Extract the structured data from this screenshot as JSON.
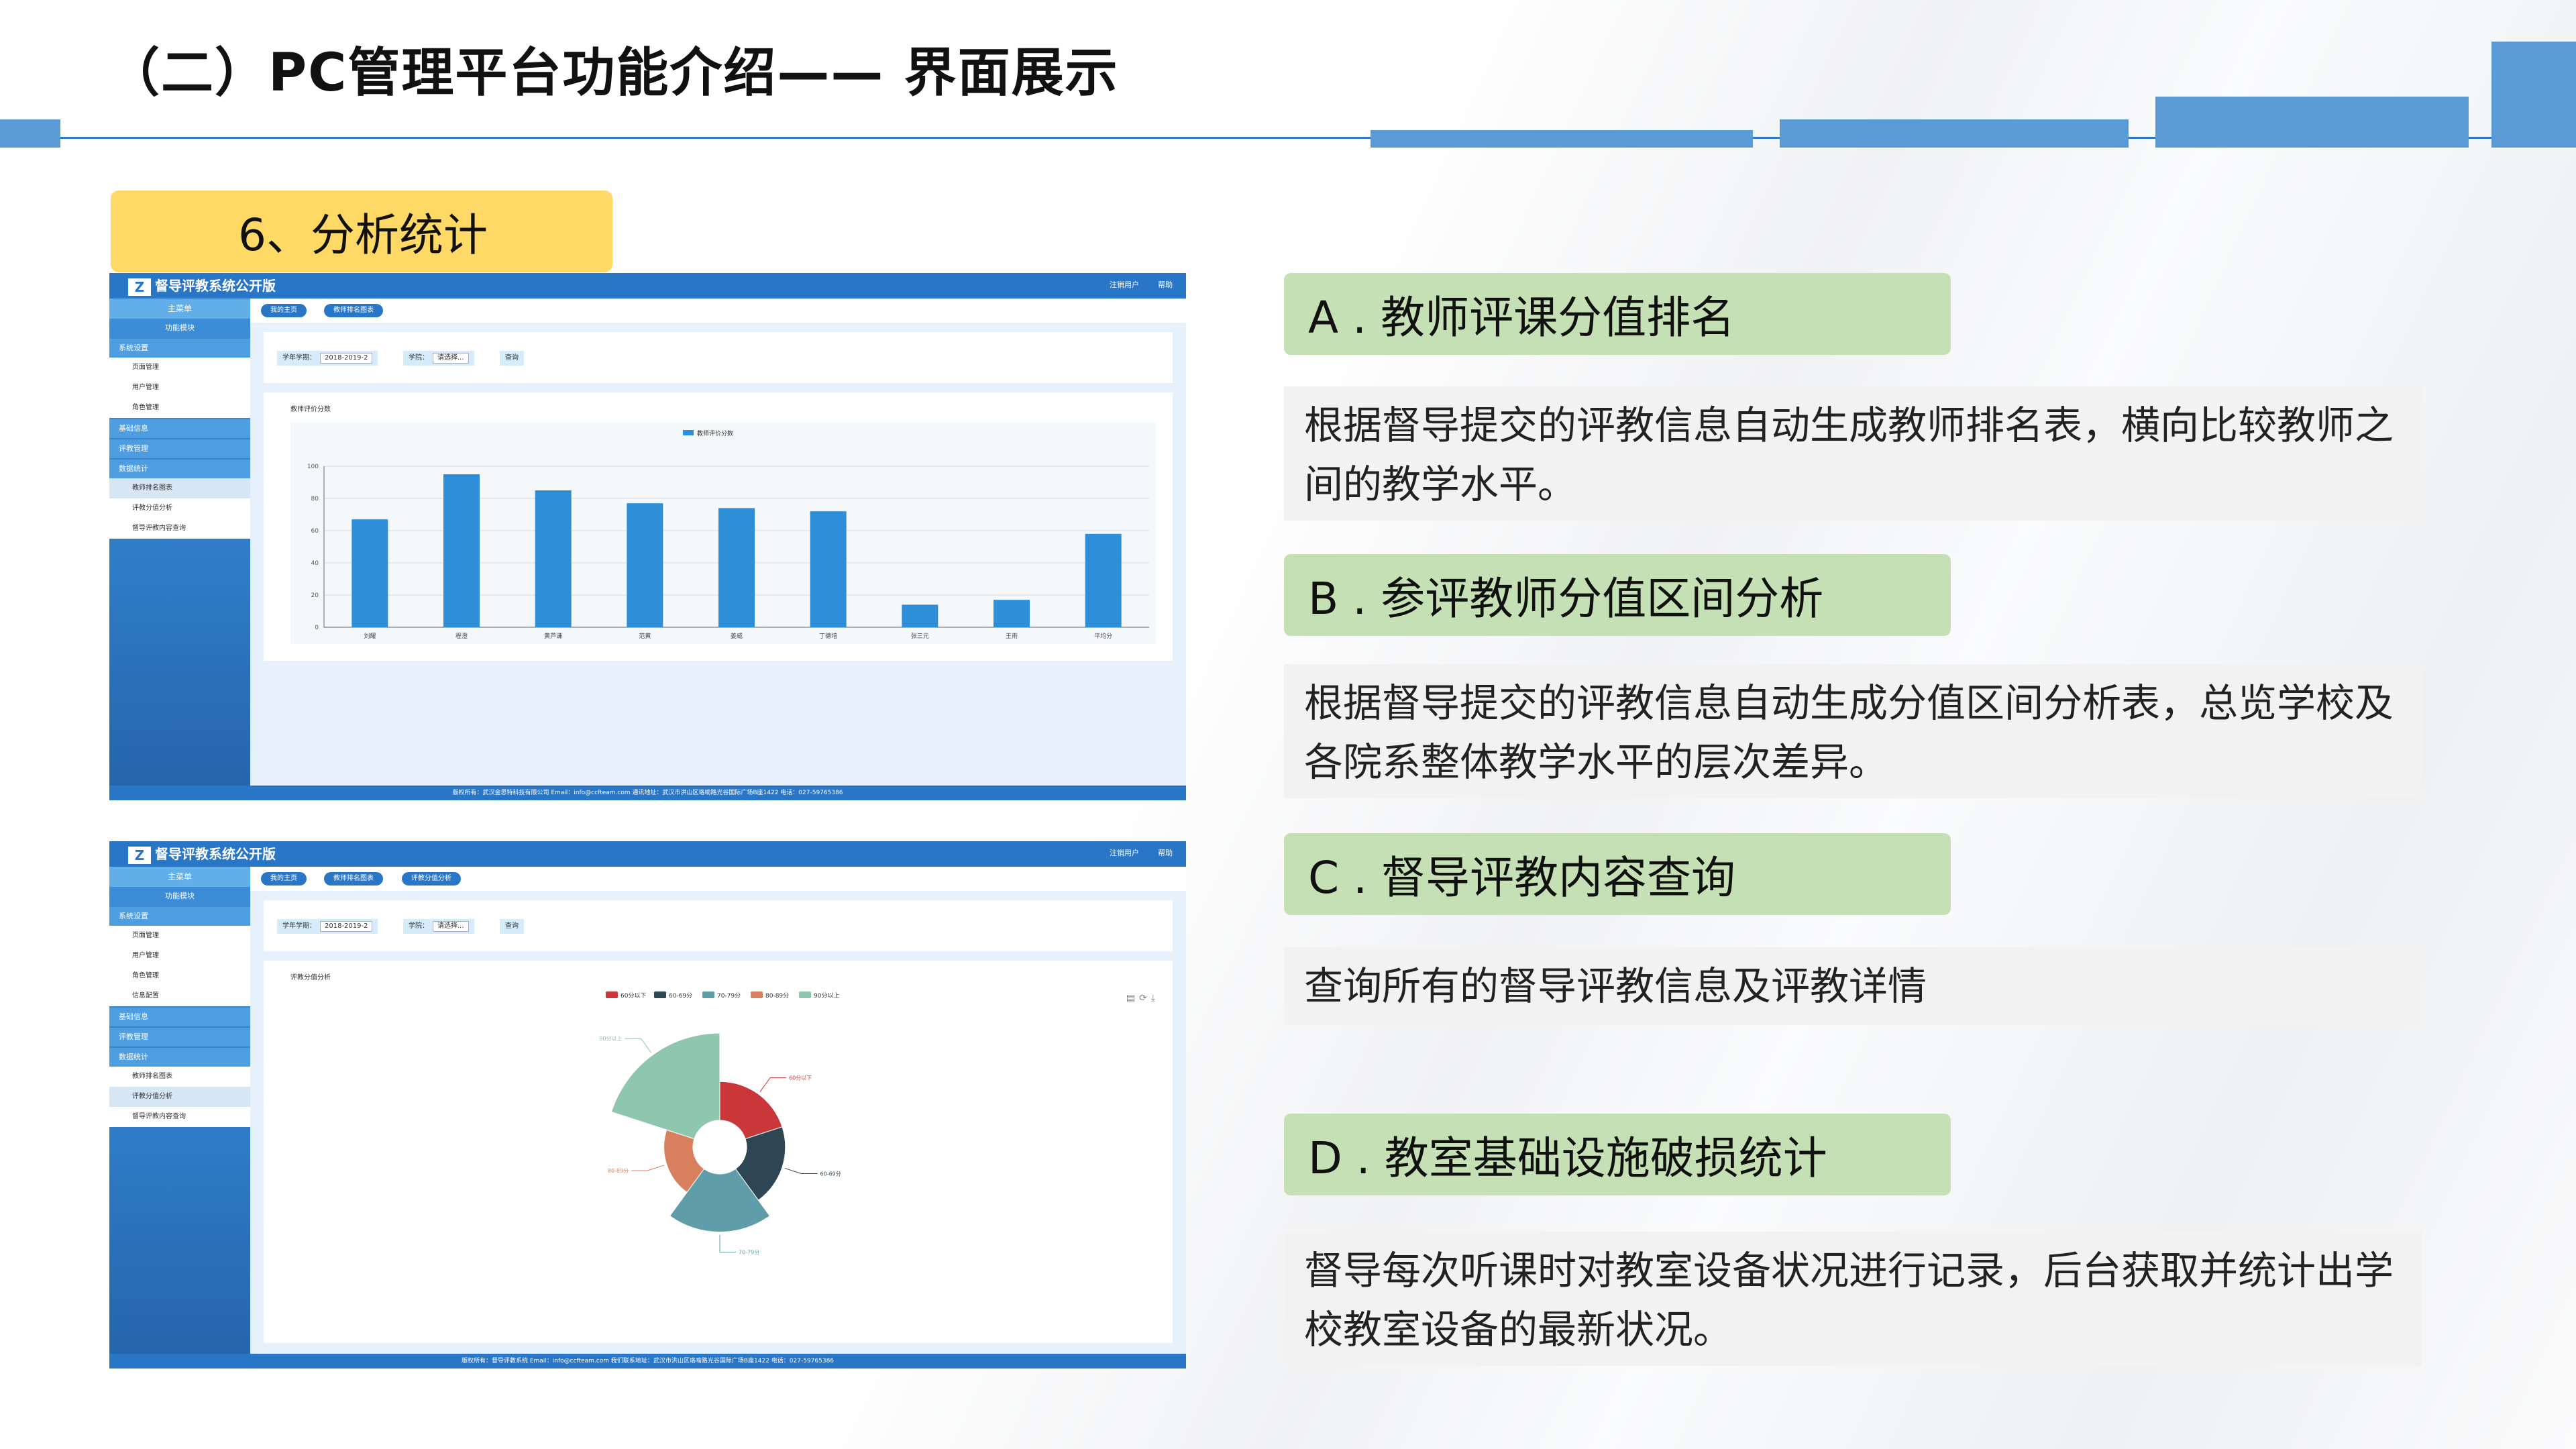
{
  "title": "（二）PC管理平台功能介绍—— 界面展示",
  "section_label": "6、分析统计",
  "items": [
    {
      "label": "A . 教师评课分值排名",
      "desc": "根据督导提交的评教信息自动生成教师排名表，横向比较教师之间的教学水平。"
    },
    {
      "label": "B . 参评教师分值区间分析",
      "desc": "根据督导提交的评教信息自动生成分值区间分析表，总览学校及各院系整体教学水平的层次差异。"
    },
    {
      "label": "C . 督导评教内容查询",
      "desc": "查询所有的督导评教信息及评教详情"
    },
    {
      "label": "D . 教室基础设施破损统计",
      "desc": "督导每次听课时对教室设备状况进行记录，后台获取并统计出学校教室设备的最新状况。"
    }
  ],
  "app": {
    "name": "督导评教系统公开版",
    "top_links": [
      "注销用户",
      "帮助"
    ],
    "sidebar": {
      "header": "主菜单",
      "func_label": "功能模块",
      "groups": [
        {
          "label": "系统设置",
          "items": [
            "页面管理",
            "用户管理",
            "角色管理",
            "信息配置"
          ]
        },
        {
          "label": "基础信息",
          "items": []
        },
        {
          "label": "评教管理",
          "items": []
        },
        {
          "label": "数据统计",
          "items": [
            "教师排名图表",
            "评教分值分析",
            "督导评教内容查询"
          ]
        }
      ]
    },
    "tabs": [
      "我的主页",
      "教师排名图表",
      "评教分值分析"
    ],
    "filter": {
      "term_label": "学年学期：",
      "term_value": "2018-2019-2",
      "college_label": "学院：",
      "college_value": "请选择...",
      "query_button": "查询"
    },
    "footer1": "版权所有：武汉金思特科技有限公司   Email：info@ccfteam.com   通讯地址：武汉市洪山区珞喻路光谷国际广场B座1422   电话：027-59765386",
    "footer2": "版权所有：督导评教系统   Email：info@ccfteam.com   我们联系地址：武汉市洪山区珞喻路光谷国际广场B座1422   电话：027-59765386"
  },
  "chart_data": [
    {
      "type": "bar",
      "title": "教师评价分数",
      "series": [
        {
          "name": "教师评价分数",
          "values": [
            67,
            95,
            85,
            77,
            74,
            72,
            14,
            17,
            58
          ]
        }
      ],
      "categories": [
        "刘耀",
        "程澄",
        "黄芦谦",
        "范黄",
        "姜威",
        "丁德培",
        "张三元",
        "王雨",
        "平均分"
      ],
      "ylim": [
        0,
        100
      ],
      "yticks": [
        0,
        20,
        40,
        60,
        80,
        100
      ],
      "color": "#2e8fd8",
      "grid": true,
      "legend": "top-center"
    },
    {
      "type": "pie",
      "subtype": "rose",
      "title": "评教分值分析",
      "legend": "top-center",
      "categories": [
        "60分以下",
        "60-69分",
        "70-79分",
        "80-89分",
        "90分以上"
      ],
      "values": [
        4,
        4,
        6,
        3,
        9
      ],
      "colors": [
        "#c9373a",
        "#2e4554",
        "#5f9ea8",
        "#d8805e",
        "#8fc6ae"
      ]
    }
  ]
}
